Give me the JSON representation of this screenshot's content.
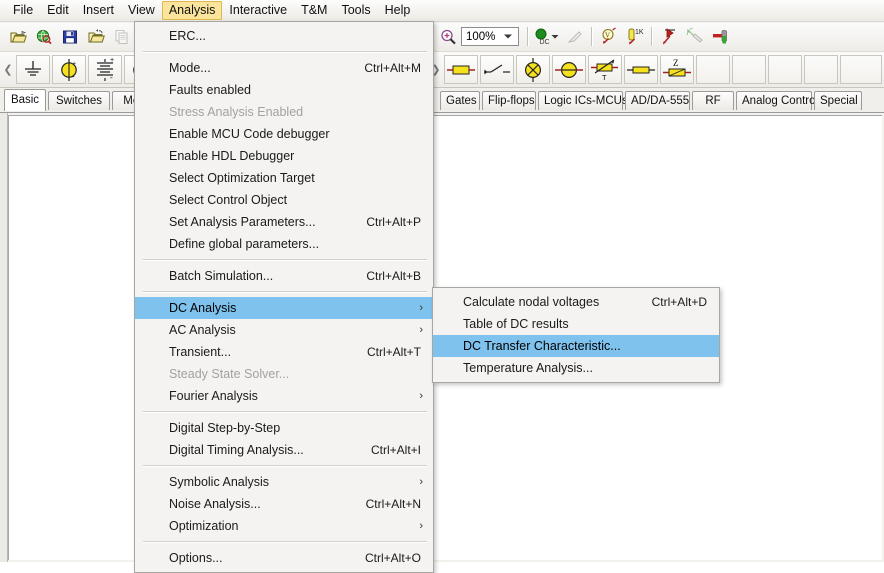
{
  "app": {
    "menubar": [
      {
        "label": "File",
        "name": "menubar-file",
        "active": false
      },
      {
        "label": "Edit",
        "name": "menubar-edit",
        "active": false
      },
      {
        "label": "Insert",
        "name": "menubar-insert",
        "active": false
      },
      {
        "label": "View",
        "name": "menubar-view",
        "active": false
      },
      {
        "label": "Analysis",
        "name": "menubar-analysis",
        "active": true
      },
      {
        "label": "Interactive",
        "name": "menubar-interactive",
        "active": false
      },
      {
        "label": "T&M",
        "name": "menubar-tm",
        "active": false
      },
      {
        "label": "Tools",
        "name": "menubar-tools",
        "active": false
      },
      {
        "label": "Help",
        "name": "menubar-help",
        "active": false
      }
    ],
    "toolbar": {
      "icons_left": [
        "open-folder-icon",
        "open-web-icon",
        "save-icon",
        "save-as-icon",
        "copy-icon"
      ],
      "zoom_icon": "zoom-in-icon",
      "zoom_value": "100%",
      "zoom_dropdown_arrow": "chevron-down-icon",
      "icons_right": [
        "dc-source-icon",
        "dc-source-dropdown-arrow",
        "probe-icon",
        "voltmeter-probe-icon",
        "resistance-probe-icon",
        "diode-arrow-icon",
        "light-probe-icon",
        "pin-icon"
      ]
    },
    "component_toolbar": {
      "left_arrow": "chevron-left-icon",
      "right_arrow": "chevron-right-icon",
      "left_icons": [
        "ground-icon",
        "dc-voltage-source-icon",
        "battery-icon",
        "ac-source-icon"
      ],
      "right_icons": [
        "resistor-icon",
        "switch-icon",
        "lamp-icon",
        "motor-icon",
        "variable-resistor-icon",
        "fuse-icon",
        "impedance-icon"
      ]
    },
    "tabs_left": [
      {
        "label": "Basic",
        "name": "tab-basic",
        "selected": true
      },
      {
        "label": "Switches",
        "name": "tab-switches",
        "selected": false
      },
      {
        "label": "Meter",
        "name": "tab-meter",
        "selected": false
      }
    ],
    "tabs_right": [
      {
        "label": "Gates",
        "name": "tab-gates"
      },
      {
        "label": "Flip-flops",
        "name": "tab-flip-flops"
      },
      {
        "label": "Logic ICs-MCUs",
        "name": "tab-logic-ics-mcus"
      },
      {
        "label": "AD/DA-555",
        "name": "tab-ad-da-555"
      },
      {
        "label": "RF",
        "name": "tab-rf"
      },
      {
        "label": "Analog Control",
        "name": "tab-analog-control"
      },
      {
        "label": "Special",
        "name": "tab-special"
      }
    ]
  },
  "analysis_menu": {
    "items": [
      {
        "kind": "item",
        "label": "ERC...",
        "accel": "",
        "state": "normal",
        "name": "menuitem-erc"
      },
      {
        "kind": "separator"
      },
      {
        "kind": "item",
        "label": "Mode...",
        "accel": "Ctrl+Alt+M",
        "state": "normal",
        "name": "menuitem-mode"
      },
      {
        "kind": "item",
        "label": "Faults enabled",
        "accel": "",
        "state": "normal",
        "name": "menuitem-faults-enabled"
      },
      {
        "kind": "item",
        "label": "Stress Analysis Enabled",
        "accel": "",
        "state": "disabled",
        "name": "menuitem-stress-analysis-enabled"
      },
      {
        "kind": "item",
        "label": "Enable MCU Code debugger",
        "accel": "",
        "state": "normal",
        "name": "menuitem-enable-mcu-code-debugger"
      },
      {
        "kind": "item",
        "label": "Enable HDL Debugger",
        "accel": "",
        "state": "normal",
        "name": "menuitem-enable-hdl-debugger"
      },
      {
        "kind": "item",
        "label": "Select Optimization Target",
        "accel": "",
        "state": "normal",
        "name": "menuitem-select-optimization-target"
      },
      {
        "kind": "item",
        "label": "Select Control Object",
        "accel": "",
        "state": "normal",
        "name": "menuitem-select-control-object"
      },
      {
        "kind": "item",
        "label": "Set Analysis Parameters...",
        "accel": "Ctrl+Alt+P",
        "state": "normal",
        "name": "menuitem-set-analysis-parameters"
      },
      {
        "kind": "item",
        "label": "Define global parameters...",
        "accel": "",
        "state": "normal",
        "name": "menuitem-define-global-parameters"
      },
      {
        "kind": "separator"
      },
      {
        "kind": "item",
        "label": "Batch Simulation...",
        "accel": "Ctrl+Alt+B",
        "state": "normal",
        "name": "menuitem-batch-simulation"
      },
      {
        "kind": "separator"
      },
      {
        "kind": "submenu",
        "label": "DC Analysis",
        "accel": "",
        "state": "highlight",
        "name": "menuitem-dc-analysis"
      },
      {
        "kind": "submenu",
        "label": "AC Analysis",
        "accel": "",
        "state": "normal",
        "name": "menuitem-ac-analysis"
      },
      {
        "kind": "item",
        "label": "Transient...",
        "accel": "Ctrl+Alt+T",
        "state": "normal",
        "name": "menuitem-transient"
      },
      {
        "kind": "item",
        "label": "Steady State Solver...",
        "accel": "",
        "state": "disabled",
        "name": "menuitem-steady-state-solver"
      },
      {
        "kind": "submenu",
        "label": "Fourier Analysis",
        "accel": "",
        "state": "normal",
        "name": "menuitem-fourier-analysis"
      },
      {
        "kind": "separator"
      },
      {
        "kind": "item",
        "label": "Digital Step-by-Step",
        "accel": "",
        "state": "normal",
        "name": "menuitem-digital-step-by-step"
      },
      {
        "kind": "item",
        "label": "Digital Timing Analysis...",
        "accel": "Ctrl+Alt+I",
        "state": "normal",
        "name": "menuitem-digital-timing-analysis"
      },
      {
        "kind": "separator"
      },
      {
        "kind": "submenu",
        "label": "Symbolic Analysis",
        "accel": "",
        "state": "normal",
        "name": "menuitem-symbolic-analysis"
      },
      {
        "kind": "item",
        "label": "Noise Analysis...",
        "accel": "Ctrl+Alt+N",
        "state": "normal",
        "name": "menuitem-noise-analysis"
      },
      {
        "kind": "submenu",
        "label": "Optimization",
        "accel": "",
        "state": "normal",
        "name": "menuitem-optimization"
      },
      {
        "kind": "separator"
      },
      {
        "kind": "item",
        "label": "Options...",
        "accel": "Ctrl+Alt+O",
        "state": "normal",
        "name": "menuitem-options"
      }
    ]
  },
  "dc_analysis_submenu": {
    "items": [
      {
        "kind": "item",
        "label": "Calculate nodal voltages",
        "accel": "Ctrl+Alt+D",
        "state": "normal",
        "name": "submenuitem-calculate-nodal-voltages"
      },
      {
        "kind": "item",
        "label": "Table of DC results",
        "accel": "",
        "state": "normal",
        "name": "submenuitem-table-of-dc-results"
      },
      {
        "kind": "item",
        "label": "DC Transfer Characteristic...",
        "accel": "",
        "state": "highlight",
        "name": "submenuitem-dc-transfer-characteristic"
      },
      {
        "kind": "item",
        "label": "Temperature Analysis...",
        "accel": "",
        "state": "normal",
        "name": "submenuitem-temperature-analysis"
      }
    ]
  },
  "colors": {
    "menu_highlight": "#7fc2ee",
    "menubar_active": "#fbe59c",
    "menu_background": "#f4f3f1",
    "disabled_text": "#a2a2a2",
    "component_yellow": "#f3e600",
    "canvas": "#ffffff"
  }
}
